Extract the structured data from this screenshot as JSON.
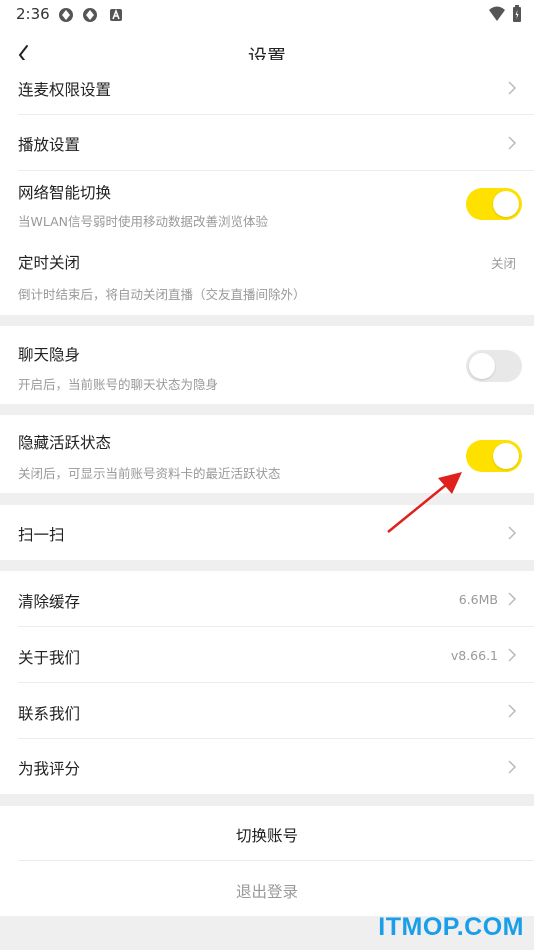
{
  "status_bar": {
    "time": "2:36",
    "icons": [
      "vpn-icon",
      "vpn-icon",
      "app-a-icon"
    ],
    "right_icons": [
      "wifi-icon",
      "battery-icon"
    ]
  },
  "header": {
    "title": "设置",
    "back_icon": "chevron-left-icon"
  },
  "sections": {
    "group1": {
      "live_permission": {
        "label": "连麦权限设置"
      },
      "playback": {
        "label": "播放设置"
      },
      "smart_switch": {
        "label": "网络智能切换",
        "sub": "当WLAN信号弱时使用移动数据改善浏览体验",
        "on": true
      },
      "timer_off": {
        "label": "定时关闭",
        "sub": "倒计时结束后，将自动关闭直播（交友直播间除外）",
        "value": "关闭"
      }
    },
    "chat_invisible": {
      "label": "聊天隐身",
      "sub": "开启后，当前账号的聊天状态为隐身",
      "on": false
    },
    "hide_active": {
      "label": "隐藏活跃状态",
      "sub": "关闭后，可显示当前账号资料卡的最近活跃状态",
      "on": true
    },
    "scan": {
      "label": "扫一扫"
    },
    "group_info": {
      "clear_cache": {
        "label": "清除缓存",
        "value": "6.6MB"
      },
      "about": {
        "label": "关于我们",
        "value": "v8.66.1"
      },
      "contact": {
        "label": "联系我们"
      },
      "rate": {
        "label": "为我评分"
      }
    },
    "account": {
      "switch": "切换账号",
      "logout": "退出登录"
    }
  },
  "watermark": "ITMOP.COM",
  "colors": {
    "toggle_on": "#ffe100",
    "toggle_off": "#e8e8e8",
    "watermark": "#1a9ee8",
    "arrow": "#e0201c"
  }
}
